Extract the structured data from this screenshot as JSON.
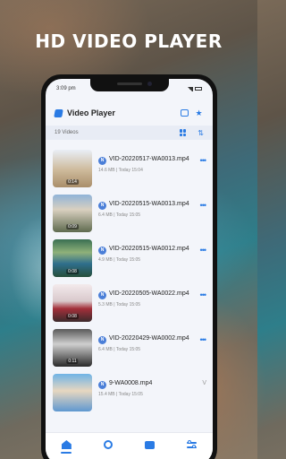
{
  "headline": "HD VIDEO PLAYER",
  "status": {
    "time": "3:09 pm"
  },
  "app": {
    "title": "Video Player"
  },
  "list_header": {
    "count": "19 Videos"
  },
  "videos": [
    {
      "name": "VID-20220517-WA0013.mp4",
      "size": "14.6 MB",
      "date": "Today 15:04",
      "duration": "0:14"
    },
    {
      "name": "VID-20220515-WA0013.mp4",
      "size": "6.4 MB",
      "date": "Today 15:05",
      "duration": "0:09"
    },
    {
      "name": "VID-20220515-WA0012.mp4",
      "size": "4.9 MB",
      "date": "Today 15:05",
      "duration": "0:08"
    },
    {
      "name": "VID-20220505-WA0022.mp4",
      "size": "5.3 MB",
      "date": "Today 15:05",
      "duration": "0:08"
    },
    {
      "name": "VID-20220429-WA0002.mp4",
      "size": "6.4 MB",
      "date": "Today 15:05",
      "duration": "0:11"
    },
    {
      "name": "9-WA0008.mp4",
      "size": "15.4 MB",
      "date": "Today 15:05",
      "duration": ""
    }
  ],
  "icons": {
    "app_logo": "play-logo-icon",
    "appbar_action_1": "folder-icon",
    "appbar_action_2": "star-icon",
    "view_toggle": "grid-icon",
    "sort": "sort-icon",
    "row_more": "more-dots-icon"
  },
  "nav": [
    "home-icon",
    "search-icon",
    "folder-icon",
    "settings-icon"
  ],
  "colors": {
    "accent": "#2a7be4",
    "badge": "#4b7fd8"
  }
}
